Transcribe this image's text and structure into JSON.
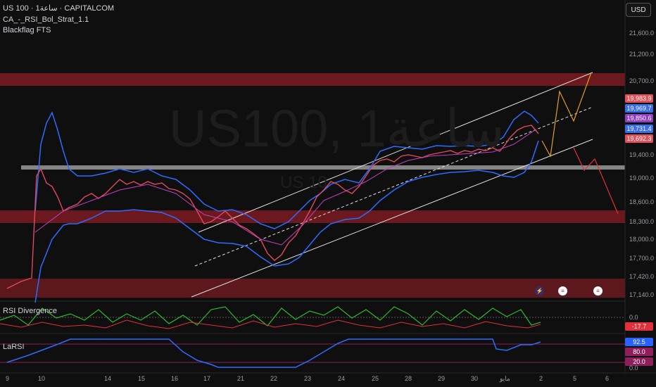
{
  "header": {
    "symbol_line": "US 100 · 1ساعة · CAPITALCOM",
    "indicator_1": "CA_-_RSI_Bol_Strat_1.1",
    "indicator_2": "Blackflag FTS",
    "watermark": "US100, 1ساعة",
    "watermark_sub": "US 10"
  },
  "currency_button": "USD",
  "price_axis": [
    "21,600.0",
    "21,200.0",
    "20,700.0",
    "19,400.0",
    "19,000.0",
    "18,600.0",
    "18,300.0",
    "18,000.0",
    "17,700.0",
    "17,420.0",
    "17,140.0"
  ],
  "price_tags": [
    {
      "label": "19,983.9",
      "color": "#e0525a"
    },
    {
      "label": "19,969.7",
      "color": "#3a6ee8"
    },
    {
      "label": "19,850.6",
      "color": "#8e3fc4"
    },
    {
      "label": "19,731.4",
      "color": "#3a6ee8"
    },
    {
      "label": "19,692.3",
      "color": "#e0525a"
    }
  ],
  "rsi_pane": {
    "title": "RSI Divergence",
    "axis": "0.0",
    "value": "-17.7",
    "value_color": "#e0303a"
  },
  "larsi_pane": {
    "title": "LaRSI",
    "axis": "0.0",
    "values": [
      {
        "label": "92.5",
        "color": "#2962ff"
      },
      {
        "label": "80.0",
        "color": "#8e1f5a"
      },
      {
        "label": "20.0",
        "color": "#8e1f5a"
      }
    ]
  },
  "time_axis": [
    "9",
    "10",
    "14",
    "15",
    "16",
    "17",
    "21",
    "22",
    "23",
    "24",
    "25",
    "28",
    "29",
    "30",
    "مايو",
    "2",
    "5",
    "6"
  ],
  "colors": {
    "background": "#0f0f0f",
    "zone": "#8b1a23",
    "bollinger": "#2e6bff",
    "support_line": "#a0a0a0",
    "projection_up": "#e0a020",
    "projection_down": "#e0303a"
  }
}
